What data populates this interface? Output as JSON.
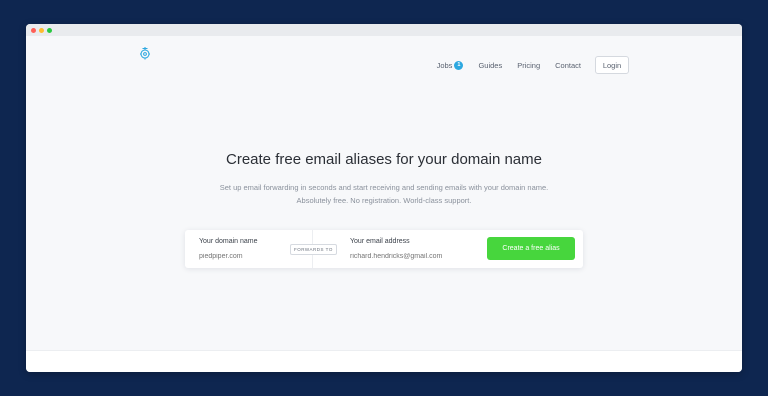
{
  "window": {
    "controls": [
      "close",
      "minimize",
      "maximize"
    ]
  },
  "nav": {
    "logo_icon": "ship-wheel-icon",
    "links": [
      {
        "label": "Jobs",
        "badge": "1"
      },
      {
        "label": "Guides"
      },
      {
        "label": "Pricing"
      },
      {
        "label": "Contact"
      }
    ],
    "login_label": "Login"
  },
  "hero": {
    "title": "Create free email aliases for your domain name",
    "subtitle_line1": "Set up email forwarding in seconds and start receiving and sending emails with your domain name.",
    "subtitle_line2": "Absolutely free. No registration. World-class support."
  },
  "form": {
    "domain_label": "Your domain name",
    "domain_placeholder": "piedpiper.com",
    "forwards_tag": "FORWARDS TO",
    "email_label": "Your email address",
    "email_placeholder": "richard.hendricks@gmail.com",
    "submit_label": "Create a free alias"
  },
  "colors": {
    "background": "#0e2650",
    "accent_green": "#47d63d",
    "badge_blue": "#2da8e0"
  }
}
